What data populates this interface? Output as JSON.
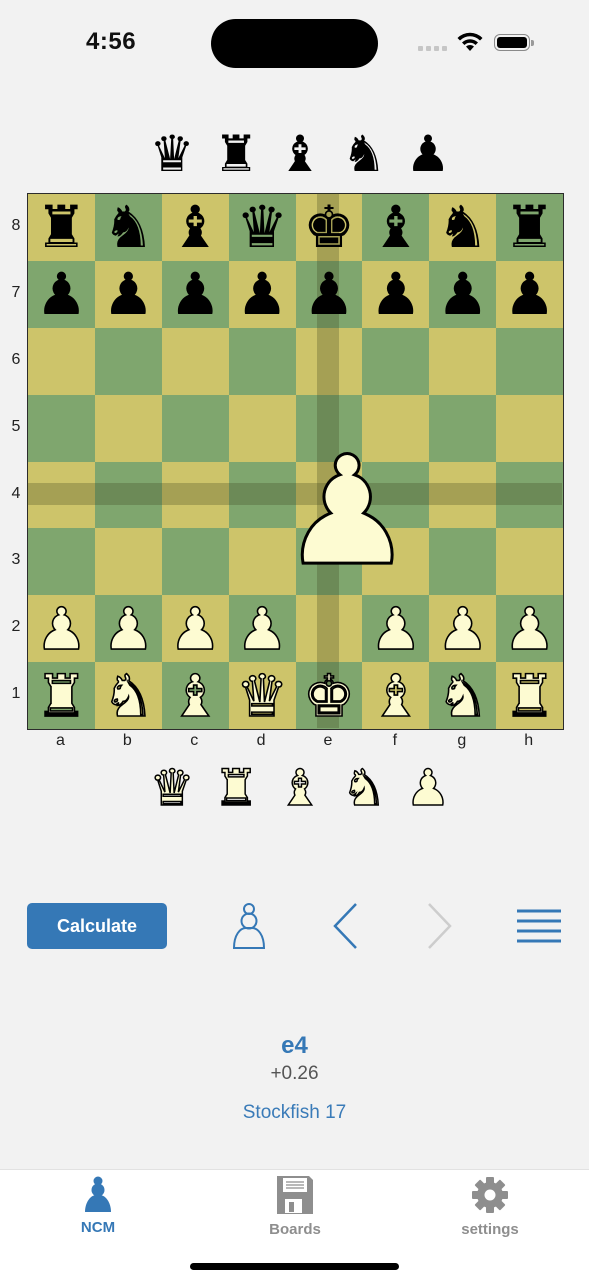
{
  "status_bar": {
    "time": "4:56"
  },
  "colors": {
    "accent": "#3578b6",
    "board_light": "#cdc46a",
    "board_dark": "#7fa66e",
    "white_piece": "#fdfbd2",
    "tab_inactive": "#8e8e8e"
  },
  "captured_top": [
    {
      "piece": "queen",
      "glyph": "♛"
    },
    {
      "piece": "rook",
      "glyph": "♜"
    },
    {
      "piece": "bishop",
      "glyph": "♝"
    },
    {
      "piece": "knight",
      "glyph": "♞"
    },
    {
      "piece": "pawn",
      "glyph": "♟"
    }
  ],
  "captured_bottom": [
    {
      "piece": "queen",
      "glyph": "♛"
    },
    {
      "piece": "rook",
      "glyph": "♜"
    },
    {
      "piece": "bishop",
      "glyph": "♝"
    },
    {
      "piece": "knight",
      "glyph": "♞"
    },
    {
      "piece": "pawn",
      "glyph": "♟"
    }
  ],
  "board": {
    "ranks": [
      "8",
      "7",
      "6",
      "5",
      "4",
      "3",
      "2",
      "1"
    ],
    "files": [
      "a",
      "b",
      "c",
      "d",
      "e",
      "f",
      "g",
      "h"
    ],
    "position": [
      [
        "br",
        "bn",
        "bb",
        "bq",
        "bk",
        "bb",
        "bn",
        "br"
      ],
      [
        "bp",
        "bp",
        "bp",
        "bp",
        "bp",
        "bp",
        "bp",
        "bp"
      ],
      [
        "",
        "",
        "",
        "",
        "",
        "",
        "",
        ""
      ],
      [
        "",
        "",
        "",
        "",
        "",
        "",
        "",
        ""
      ],
      [
        "",
        "",
        "",
        "",
        "",
        "",
        "",
        ""
      ],
      [
        "",
        "",
        "",
        "",
        "",
        "",
        "",
        ""
      ],
      [
        "wp",
        "wp",
        "wp",
        "wp",
        "",
        "wp",
        "wp",
        "wp"
      ],
      [
        "wr",
        "wn",
        "wb",
        "wq",
        "wk",
        "wb",
        "wn",
        "wr"
      ]
    ],
    "dragged_piece": {
      "piece": "wp",
      "glyph": "♟",
      "target_square": "e4"
    },
    "highlight_file": "e",
    "highlight_rank": "4"
  },
  "toolbar": {
    "calculate_label": "Calculate",
    "pawn_icon": "pawn-outline",
    "back_icon": "chevron-left",
    "forward_icon": "chevron-right",
    "forward_enabled": false,
    "menu_icon": "hamburger"
  },
  "evaluation": {
    "move": "e4",
    "score": "+0.26",
    "engine": "Stockfish 17"
  },
  "tabbar": {
    "tabs": [
      {
        "label": "NCM",
        "icon": "pawn-icon",
        "active": true
      },
      {
        "label": "Boards",
        "icon": "floppy-disk-icon",
        "active": false
      },
      {
        "label": "settings",
        "icon": "gear-icon",
        "active": false
      }
    ]
  }
}
